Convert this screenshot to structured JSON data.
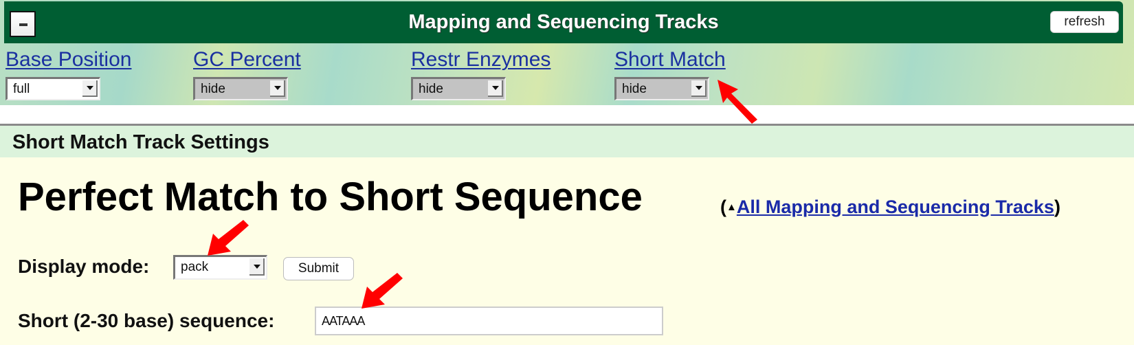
{
  "header": {
    "collapse_label": "−",
    "title": "Mapping and Sequencing Tracks",
    "refresh_label": "refresh",
    "color": "#005e33"
  },
  "tracks": [
    {
      "name": "Base Position",
      "mode": "full"
    },
    {
      "name": "GC Percent",
      "mode": "hide"
    },
    {
      "name": "Restr Enzymes",
      "mode": "hide"
    },
    {
      "name": "Short Match",
      "mode": "hide"
    }
  ],
  "settings": {
    "section_title": "Short Match Track Settings",
    "page_title": "Perfect Match to Short Sequence",
    "backlink_open": "(",
    "backlink_arrow": "▲",
    "backlink_label": "All Mapping and Sequencing Tracks",
    "backlink_close": ")",
    "display_mode_label": "Display mode:",
    "display_mode_value": "pack",
    "submit_label": "Submit",
    "sequence_label": "Short (2-30 base) sequence:",
    "sequence_value": "AATAAA"
  },
  "annotations": {
    "arrow_color": "#ff0000",
    "arrows": [
      "points-to-short-match-link",
      "points-to-display-mode-select",
      "points-to-sequence-input"
    ]
  }
}
